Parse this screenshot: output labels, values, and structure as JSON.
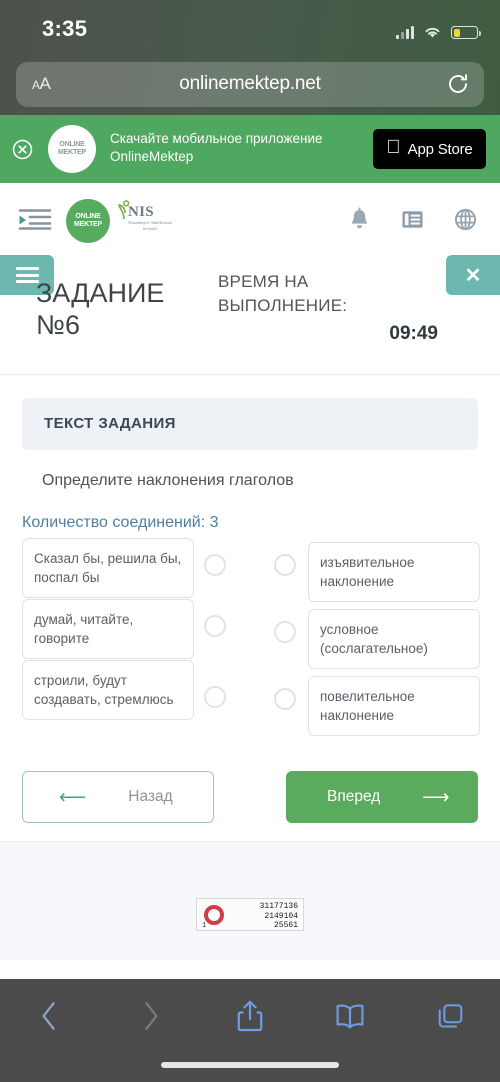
{
  "status_bar": {
    "time": "3:35",
    "icons": [
      "cellular-signal-icon",
      "wifi-icon",
      "battery-icon"
    ],
    "battery_level_pct": 28
  },
  "browser": {
    "url": "onlinemektep.net",
    "text_size_button": "AA",
    "reload_icon": "reload-icon",
    "toolbar": {
      "back_icon": "chevron-left-icon",
      "forward_icon": "chevron-right-icon",
      "share_icon": "share-icon",
      "bookmarks_icon": "book-icon",
      "tabs_icon": "tabs-icon"
    }
  },
  "promo_banner": {
    "close_icon": "close-circle-icon",
    "logo_line1": "ONLINE",
    "logo_line2": "MEKTEP",
    "text_line1": "Скачайте мобильное приложение",
    "text_line2": "OnlineMektep",
    "store_button": "App Store",
    "apple_icon": "apple-icon",
    "background_color": "#4fa860"
  },
  "site_header": {
    "sidebar_toggle_icon": "sidebar-toggle-icon",
    "om_logo_line1": "ONLINE",
    "om_logo_line2": "MEKTEP",
    "nis_logo_main": "NIS",
    "nis_logo_sub": "Nazarbayev Intellectual Schools",
    "icons": [
      "bell-icon",
      "list-icon",
      "globe-icon"
    ]
  },
  "task_header": {
    "menu_icon": "hamburger-menu-icon",
    "close_icon": "close-icon",
    "task_title": "ЗАДАНИЕ №6",
    "timer_label": "ВРЕМЯ НА ВЫПОЛНЕНИЕ:",
    "timer_value": "09:49",
    "accent_color": "#6cb7ae"
  },
  "task": {
    "card_header": "ТЕКСТ ЗАДАНИЯ",
    "prompt": "Определите наклонения глаголов",
    "connections_text": "Количество соединений: 3",
    "connections_color": "#4d7fa3",
    "left_options": [
      "Сказал бы, решила бы, поспал бы",
      "думай, читайте, говорите",
      "строили, будут создавать, стремлюсь"
    ],
    "right_options": [
      "изъявительное наклонение",
      "условное (сослагательное)",
      "повелительное наклонение"
    ]
  },
  "navigation": {
    "back_label": "Назад",
    "back_arrow": "arrow-left-icon",
    "forward_label": "Вперед",
    "forward_arrow": "arrow-right-icon",
    "forward_color": "#5bab5f"
  },
  "page_footer": {
    "counter": {
      "ring_icon": "red-ring-icon",
      "index": "1",
      "line1": "31177136",
      "line2": "2149104",
      "line3": "25561"
    }
  }
}
